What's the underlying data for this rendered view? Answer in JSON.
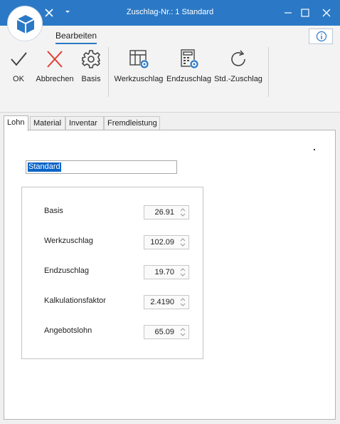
{
  "window": {
    "title": "Zuschlag-Nr.: 1 Standard"
  },
  "ribbon": {
    "tab": "Bearbeiten",
    "buttons": {
      "ok": "OK",
      "cancel": "Abbrechen",
      "basis": "Basis",
      "werkzuschlag": "Werkzuschlag",
      "endzuschlag": "Endzuschlag",
      "std_zuschlag": "Std.-Zuschlag"
    }
  },
  "tabs": [
    "Lohn",
    "Material",
    "Inventar",
    "Fremdleistung"
  ],
  "active_tab": "Lohn",
  "name_field": {
    "value": "Standard"
  },
  "fields": [
    {
      "label": "Basis",
      "value": "26.91"
    },
    {
      "label": "Werkzuschlag",
      "value": "102.09"
    },
    {
      "label": "Endzuschlag",
      "value": "19.70"
    },
    {
      "label": "Kalkulationsfaktor",
      "value": "2.4190"
    },
    {
      "label": "Angebotslohn",
      "value": "65.09"
    }
  ],
  "colors": {
    "titlebar": "#2b79c6",
    "accent_blue": "#2b79c6",
    "cancel_red": "#e03c31",
    "selection": "#0a64c8"
  },
  "icons": {
    "app": "box-icon",
    "ok": "checkmark-icon",
    "cancel": "x-icon",
    "basis": "gear-icon",
    "werkzuschlag": "table-gear-icon",
    "endzuschlag": "calculator-gear-icon",
    "std_zuschlag": "refresh-icon",
    "info": "info-icon"
  }
}
